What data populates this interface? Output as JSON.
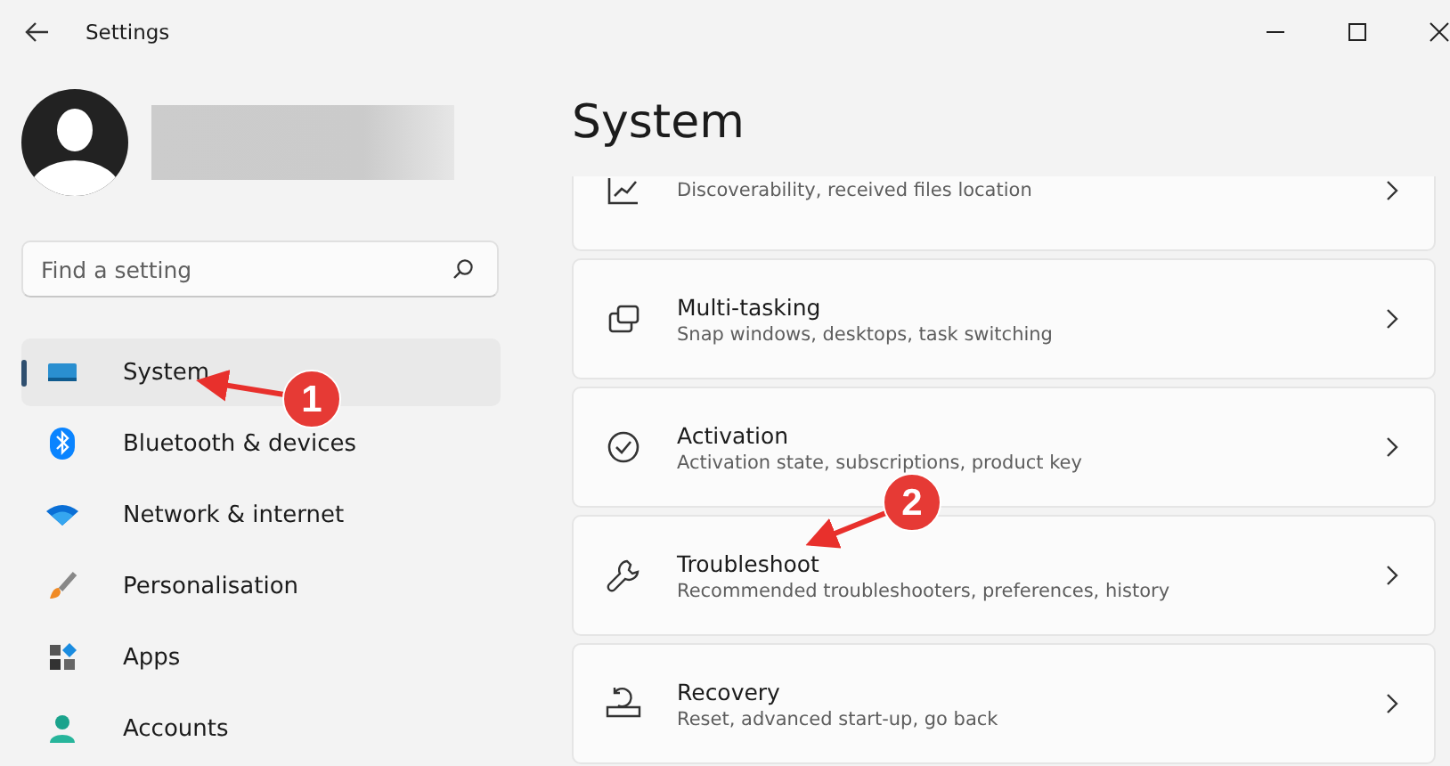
{
  "window": {
    "title": "Settings"
  },
  "search": {
    "placeholder": "Find a setting"
  },
  "sidebar": {
    "items": [
      {
        "label": "System",
        "selected": true
      },
      {
        "label": "Bluetooth & devices",
        "selected": false
      },
      {
        "label": "Network & internet",
        "selected": false
      },
      {
        "label": "Personalisation",
        "selected": false
      },
      {
        "label": "Apps",
        "selected": false
      },
      {
        "label": "Accounts",
        "selected": false
      }
    ]
  },
  "page_title": "System",
  "cards": [
    {
      "subtitle": "Discoverability, received files location"
    },
    {
      "title": "Multi-tasking",
      "subtitle": "Snap windows, desktops, task switching"
    },
    {
      "title": "Activation",
      "subtitle": "Activation state, subscriptions, product key"
    },
    {
      "title": "Troubleshoot",
      "subtitle": "Recommended troubleshooters, preferences, history"
    },
    {
      "title": "Recovery",
      "subtitle": "Reset, advanced start-up, go back"
    }
  ],
  "annotations": [
    {
      "label": "1"
    },
    {
      "label": "2"
    }
  ]
}
